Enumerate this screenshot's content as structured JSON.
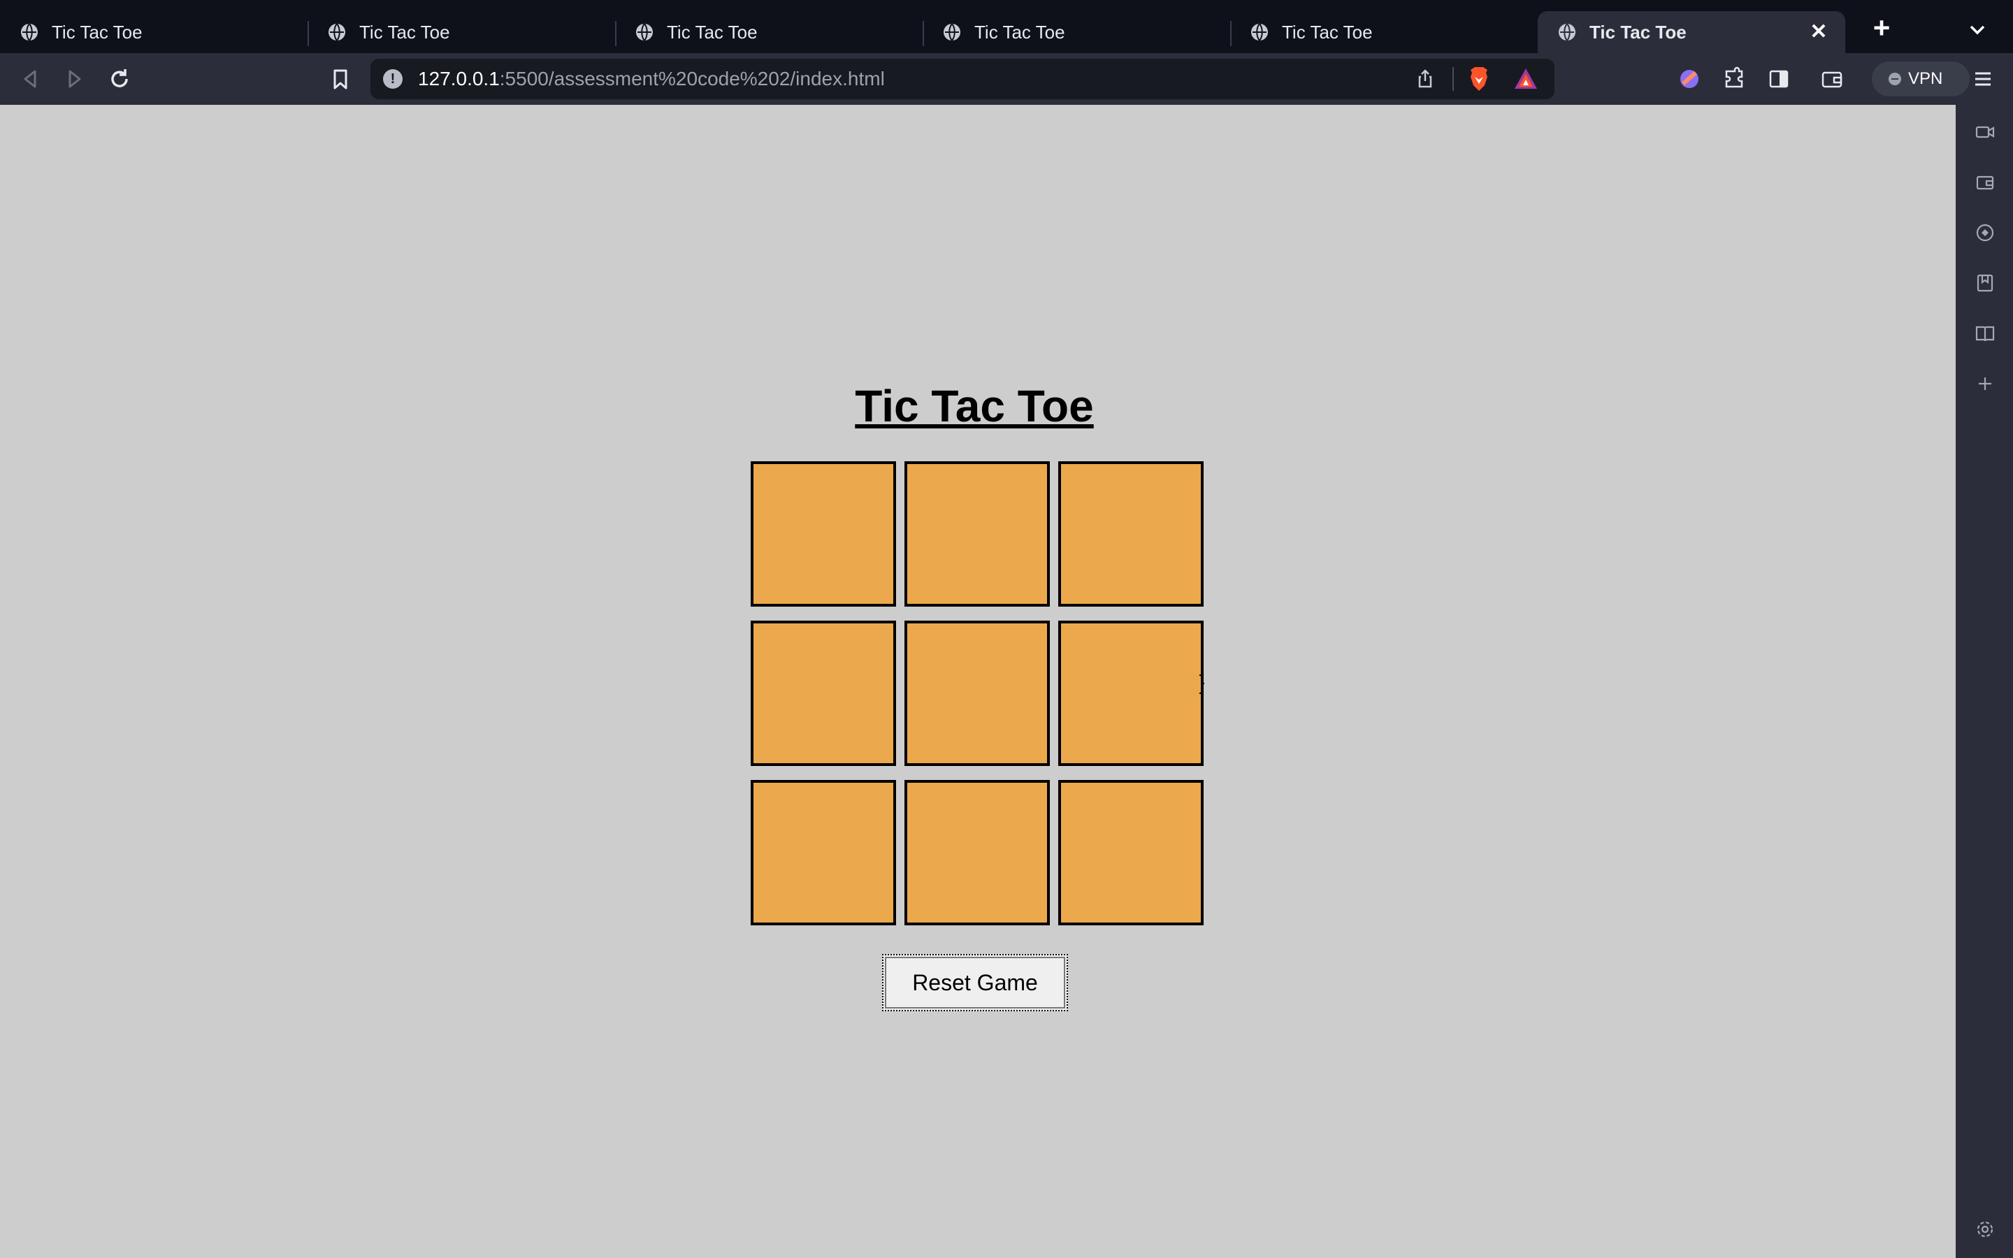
{
  "browser": {
    "tabs": [
      {
        "title": "Tic Tac Toe",
        "active": false
      },
      {
        "title": "Tic Tac Toe",
        "active": false
      },
      {
        "title": "Tic Tac Toe",
        "active": false
      },
      {
        "title": "Tic Tac Toe",
        "active": false
      },
      {
        "title": "Tic Tac Toe",
        "active": false
      },
      {
        "title": "Tic Tac Toe",
        "active": true
      }
    ],
    "tab_close_label": "✕",
    "new_tab_label": "+",
    "url": {
      "host": "127.0.0.1",
      "path": ":5500/assessment%20code%202/index.html"
    },
    "vpn_label": "VPN",
    "colors": {
      "tabstrip": "#0f111a",
      "toolbar": "#2b2e3a",
      "urlbar": "#181a21"
    }
  },
  "game": {
    "title": "Tic Tac Toe",
    "cells": [
      "",
      "",
      "",
      "",
      "",
      "",
      "",
      "",
      ""
    ],
    "reset_label": "Reset Game",
    "colors": {
      "cell": "#eca84c",
      "border": "#000000",
      "background": "#cdcdcd"
    }
  }
}
